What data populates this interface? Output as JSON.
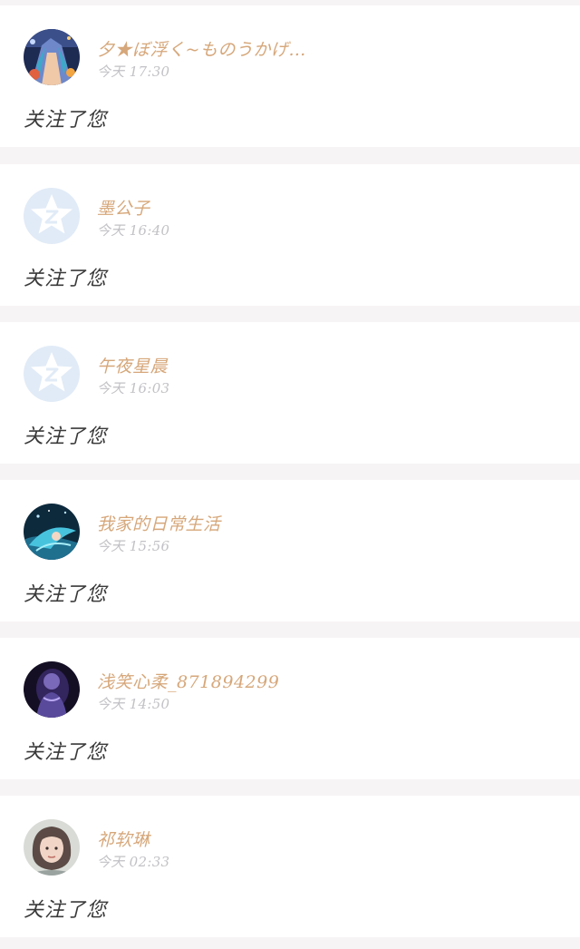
{
  "notifications": [
    {
      "username": "夕★ぼ浮く~ものうかげ…",
      "time": "今天 17:30",
      "message": "关注了您",
      "avatar": "anime-girl-colorful-avatar"
    },
    {
      "username": "墨公子",
      "time": "今天 16:40",
      "message": "关注了您",
      "avatar": "default-star-avatar"
    },
    {
      "username": "午夜星晨",
      "time": "今天 16:03",
      "message": "关注了您",
      "avatar": "default-star-avatar"
    },
    {
      "username": "我家的日常生活",
      "time": "今天 15:56",
      "message": "关注了您",
      "avatar": "anime-blue-hair-avatar"
    },
    {
      "username": "浅笑心柔_871894299",
      "time": "今天 14:50",
      "message": "关注了您",
      "avatar": "dark-purple-figure-avatar"
    },
    {
      "username": "祁软琳",
      "time": "今天 02:33",
      "message": "关注了您",
      "avatar": "portrait-photo-avatar"
    }
  ],
  "colors": {
    "background": "#f7f4f5",
    "card": "#ffffff",
    "username": "#d6a77a",
    "time": "#c2c2c6",
    "message": "#3a3a3a",
    "default_avatar_bg": "#e1ebf7"
  }
}
